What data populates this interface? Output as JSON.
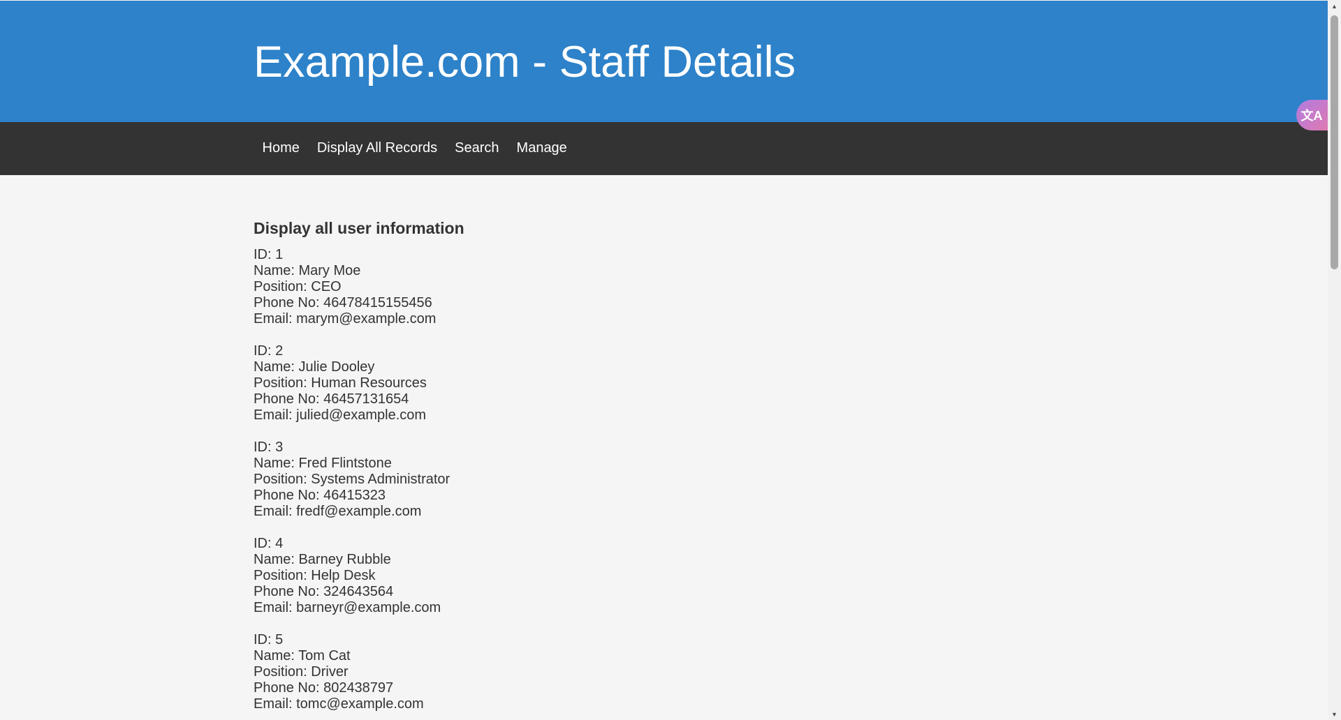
{
  "header": {
    "title": "Example.com - Staff Details"
  },
  "nav": {
    "items": [
      {
        "label": "Home"
      },
      {
        "label": "Display All Records"
      },
      {
        "label": "Search"
      },
      {
        "label": "Manage"
      }
    ]
  },
  "main": {
    "heading": "Display all user information",
    "records": [
      {
        "id": "ID: 1",
        "name": "Name: Mary Moe",
        "position": "Position: CEO",
        "phone": "Phone No: 46478415155456",
        "email": "Email: marym@example.com"
      },
      {
        "id": "ID: 2",
        "name": "Name: Julie Dooley",
        "position": "Position: Human Resources",
        "phone": "Phone No: 46457131654",
        "email": "Email: julied@example.com"
      },
      {
        "id": "ID: 3",
        "name": "Name: Fred Flintstone",
        "position": "Position: Systems Administrator",
        "phone": "Phone No: 46415323",
        "email": "Email: fredf@example.com"
      },
      {
        "id": "ID: 4",
        "name": "Name: Barney Rubble",
        "position": "Position: Help Desk",
        "phone": "Phone No: 324643564",
        "email": "Email: barneyr@example.com"
      },
      {
        "id": "ID: 5",
        "name": "Name: Tom Cat",
        "position": "Position: Driver",
        "phone": "Phone No: 802438797",
        "email": "Email: tomc@example.com"
      }
    ]
  },
  "widgets": {
    "translate_icon": "translate-icon",
    "translate_glyph": "文A"
  },
  "colors": {
    "header_bg": "#2d82c9",
    "nav_bg": "#333333",
    "page_bg": "#f5f5f5",
    "text": "#333333"
  }
}
